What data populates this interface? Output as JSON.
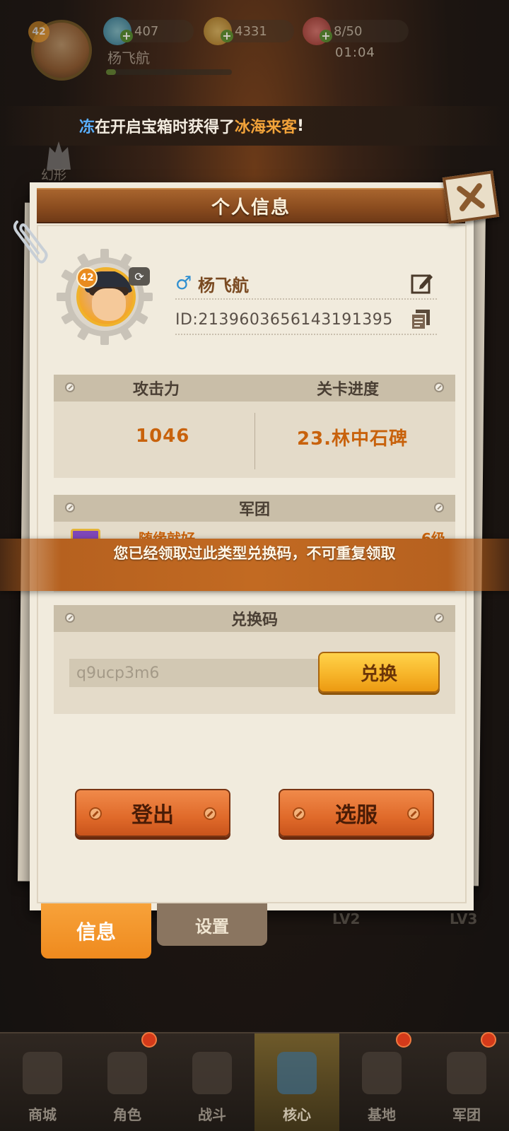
{
  "hud": {
    "level": "42",
    "player_name": "杨飞航",
    "exp_fraction": 0.08,
    "gems": "407",
    "coins": "4331",
    "stamina": "8/50",
    "stamina_timer": "01:04"
  },
  "ticker": {
    "cut_prefix": "冻",
    "text_before": "在开启宝箱时获得了",
    "highlight": "冰海来客",
    "text_after": "!"
  },
  "side": {
    "label": "幻形"
  },
  "panel": {
    "title": "个人信息",
    "profile": {
      "level": "42",
      "gender_symbol": "♂",
      "name": "杨飞航",
      "id_text": "ID:2139603656143191395"
    },
    "stats": {
      "attack_label": "攻击力",
      "attack_value": "1046",
      "progress_label": "关卡进度",
      "progress_value": "23.林中石碑"
    },
    "legion": {
      "header": "军团",
      "name": "随缘就好",
      "level": "6级"
    },
    "redeem": {
      "header": "兑换码",
      "input_value": "q9ucp3m6",
      "button": "兑换"
    },
    "logout_button": "登出",
    "select_server_button": "选服"
  },
  "toast": {
    "message": "您已经领取过此类型兑换码，不可重复领取"
  },
  "tabs": {
    "info": "信息",
    "settings": "设置",
    "bg_lv2": "LV2",
    "bg_lv3": "LV3"
  },
  "nav": [
    {
      "label": "商城",
      "badge": false
    },
    {
      "label": "角色",
      "badge": true
    },
    {
      "label": "战斗",
      "badge": false
    },
    {
      "label": "核心",
      "badge": false,
      "active": true
    },
    {
      "label": "基地",
      "badge": true
    },
    {
      "label": "军团",
      "badge": true
    }
  ],
  "colors": {
    "accent_orange": "#c8620c",
    "title_brown": "#8b4c1f",
    "gender_blue": "#2f8fd0"
  }
}
